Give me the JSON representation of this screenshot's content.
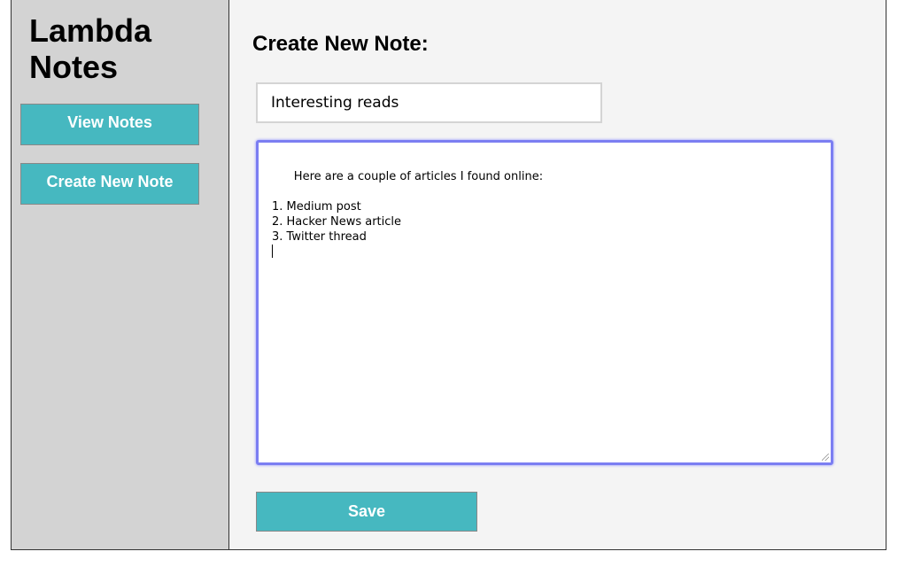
{
  "sidebar": {
    "app_title": "Lambda Notes",
    "nav": {
      "view_notes_label": "View Notes",
      "create_note_label": "Create New Note"
    }
  },
  "main": {
    "heading": "Create New Note:",
    "title_field": {
      "value": "Interesting reads"
    },
    "body_field": {
      "value": "Here are a couple of articles I found online:\n\n1. Medium post\n2. Hacker News article\n3. Twitter thread\n",
      "focused": true
    },
    "save_label": "Save"
  },
  "colors": {
    "sidebar_bg": "#d3d3d3",
    "main_bg": "#f4f4f4",
    "button_accent": "#46b8c0",
    "focus_ring": "#7b7ef2"
  }
}
